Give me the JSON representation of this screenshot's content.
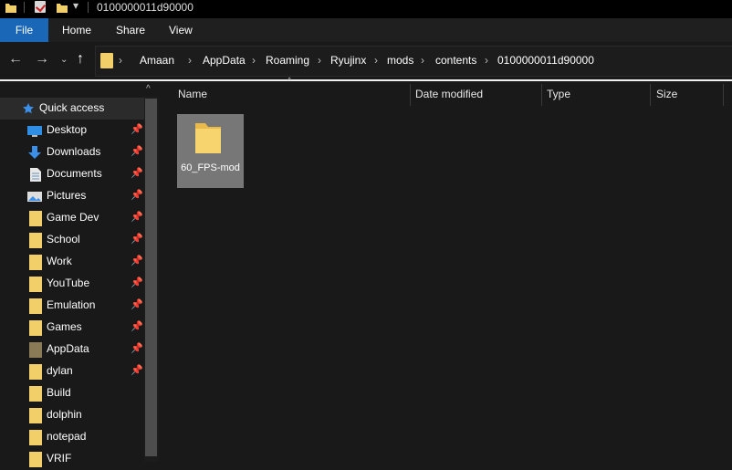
{
  "window": {
    "title": "0100000011d90000"
  },
  "ribbon": {
    "tabs": [
      "File",
      "Home",
      "Share",
      "View"
    ]
  },
  "address": {
    "crumbs": [
      "Amaan",
      "AppData",
      "Roaming",
      "Ryujinx",
      "mods",
      "contents",
      "0100000011d90000"
    ],
    "separator": "›"
  },
  "nav": {
    "quick_access": "Quick access",
    "items": [
      {
        "label": "Desktop",
        "icon": "desktop-icon"
      },
      {
        "label": "Downloads",
        "icon": "download-icon"
      },
      {
        "label": "Documents",
        "icon": "document-icon"
      },
      {
        "label": "Pictures",
        "icon": "picture-icon"
      },
      {
        "label": "Game Dev",
        "icon": "folder-icon"
      },
      {
        "label": "School",
        "icon": "folder-icon"
      },
      {
        "label": "Work",
        "icon": "folder-icon"
      },
      {
        "label": "YouTube",
        "icon": "folder-icon"
      },
      {
        "label": "Emulation",
        "icon": "folder-icon"
      },
      {
        "label": "Games",
        "icon": "folder-icon"
      },
      {
        "label": "AppData",
        "icon": "folder-icon"
      },
      {
        "label": "dylan",
        "icon": "folder-icon"
      },
      {
        "label": "Build",
        "icon": "folder-icon"
      },
      {
        "label": "dolphin",
        "icon": "folder-icon"
      },
      {
        "label": "notepad",
        "icon": "folder-icon"
      },
      {
        "label": "VRIF",
        "icon": "folder-icon"
      }
    ]
  },
  "content": {
    "columns": [
      "Name",
      "Date modified",
      "Type",
      "Size"
    ],
    "items": [
      {
        "name": "60_FPS-mod",
        "icon": "folder-icon"
      }
    ]
  },
  "colors": {
    "accent": "#1a67b8",
    "folder": "#f3cf6a",
    "selected_tile": "#777777"
  }
}
